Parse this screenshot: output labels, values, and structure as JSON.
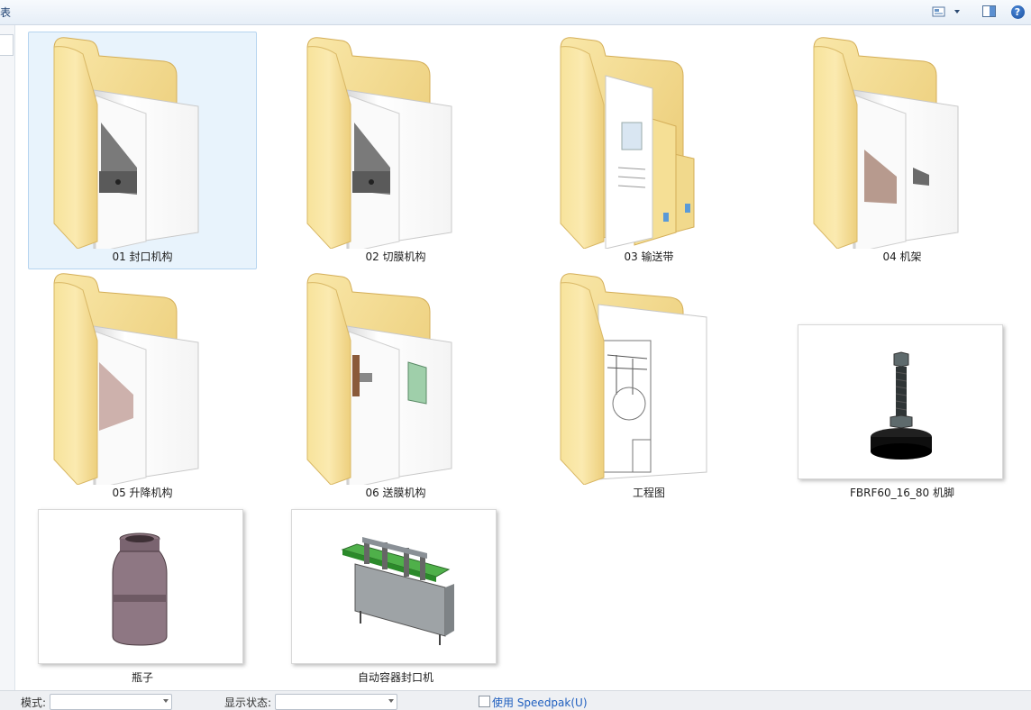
{
  "toolbar": {
    "left_fragment": "表",
    "view_icon": "views-icon",
    "pane_icon": "preview-pane-icon",
    "help_label": "?"
  },
  "items": [
    {
      "label": "01 封口机构",
      "type": "folder",
      "selected": true
    },
    {
      "label": "02 切膜机构",
      "type": "folder",
      "selected": false
    },
    {
      "label": "03 输送带",
      "type": "folder",
      "selected": false
    },
    {
      "label": "04 机架",
      "type": "folder",
      "selected": false
    },
    {
      "label": "05 升降机构",
      "type": "folder",
      "selected": false
    },
    {
      "label": "06 送膜机构",
      "type": "folder",
      "selected": false
    },
    {
      "label": "工程图",
      "type": "folder",
      "selected": false
    },
    {
      "label": "FBRF60_16_80 机脚",
      "type": "part-file",
      "selected": false
    },
    {
      "label": "瓶子",
      "type": "part-file",
      "selected": false
    },
    {
      "label": "自动容器封口机",
      "type": "assembly-file",
      "selected": false
    }
  ],
  "statusbar": {
    "mode_label": "模式:",
    "mode_value": "",
    "display_state_label": "显示状态:",
    "display_state_value": "",
    "speedpak_label": "使用 Speedpak(U)",
    "speedpak_checked": false
  }
}
